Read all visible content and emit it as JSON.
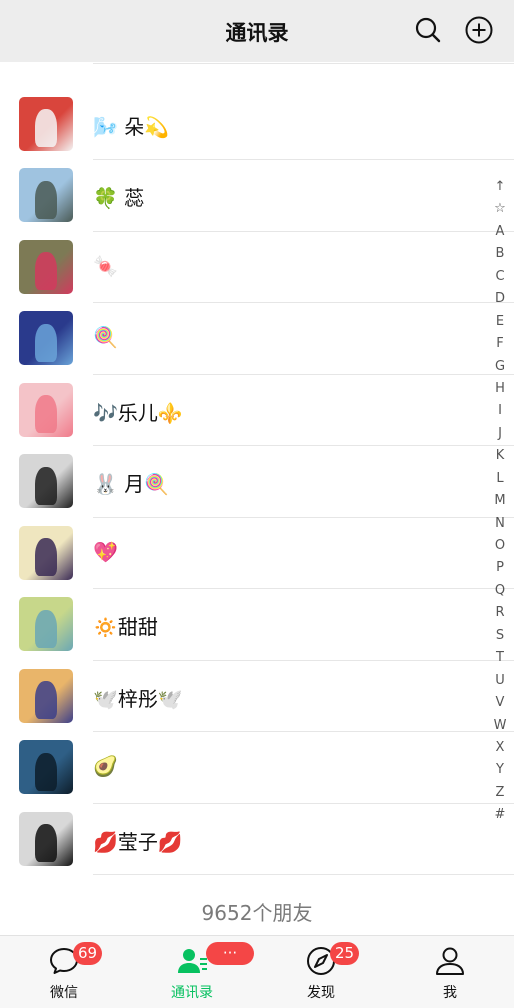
{
  "header": {
    "title": "通讯录",
    "search_icon": "search-icon",
    "add_icon": "plus-circle-icon"
  },
  "contacts": [
    {
      "name": "",
      "avatar_colors": [
        "#ffffff",
        "#bfbfbf"
      ]
    },
    {
      "name": "🌬️ 朵💫",
      "avatar_colors": [
        "#d9453c",
        "#f4f4f4"
      ]
    },
    {
      "name": "🍀 蕊",
      "avatar_colors": [
        "#9fc3e0",
        "#4a5a55"
      ]
    },
    {
      "name": "🍬",
      "avatar_colors": [
        "#7d7a55",
        "#d23a5e"
      ]
    },
    {
      "name": "🍭",
      "avatar_colors": [
        "#2a3a8c",
        "#6aa3d8"
      ]
    },
    {
      "name": "🎶乐儿⚜️",
      "avatar_colors": [
        "#f4c3c8",
        "#f07a8a"
      ]
    },
    {
      "name": "🐰 月🍭",
      "avatar_colors": [
        "#d6d6d6",
        "#1e1e1e"
      ]
    },
    {
      "name": "💖",
      "avatar_colors": [
        "#efe6bf",
        "#3a2a55"
      ]
    },
    {
      "name": "🔅甜甜",
      "avatar_colors": [
        "#c7d78a",
        "#6aa7b5"
      ]
    },
    {
      "name": "🕊️梓彤🕊️",
      "avatar_colors": [
        "#e9b56a",
        "#3c3f8a"
      ]
    },
    {
      "name": "🥑",
      "avatar_colors": [
        "#2f5f86",
        "#0d1d2a"
      ]
    },
    {
      "name": "💋莹子💋",
      "avatar_colors": [
        "#d8d8d8",
        "#111111"
      ]
    }
  ],
  "friend_count": "9652个朋友",
  "index_letters": [
    "↑",
    "☆",
    "A",
    "B",
    "C",
    "D",
    "E",
    "F",
    "G",
    "H",
    "I",
    "J",
    "K",
    "L",
    "M",
    "N",
    "O",
    "P",
    "Q",
    "R",
    "S",
    "T",
    "U",
    "V",
    "W",
    "X",
    "Y",
    "Z",
    "#"
  ],
  "tabbar": {
    "accent": "#07c160",
    "badge_color": "#f44646",
    "tabs": [
      {
        "label": "微信",
        "icon": "chat-bubble-icon",
        "badge": "69"
      },
      {
        "label": "通讯录",
        "icon": "contacts-icon",
        "badge": "···",
        "active": true
      },
      {
        "label": "发现",
        "icon": "compass-icon",
        "badge": "25"
      },
      {
        "label": "我",
        "icon": "person-icon",
        "badge": ""
      }
    ]
  }
}
